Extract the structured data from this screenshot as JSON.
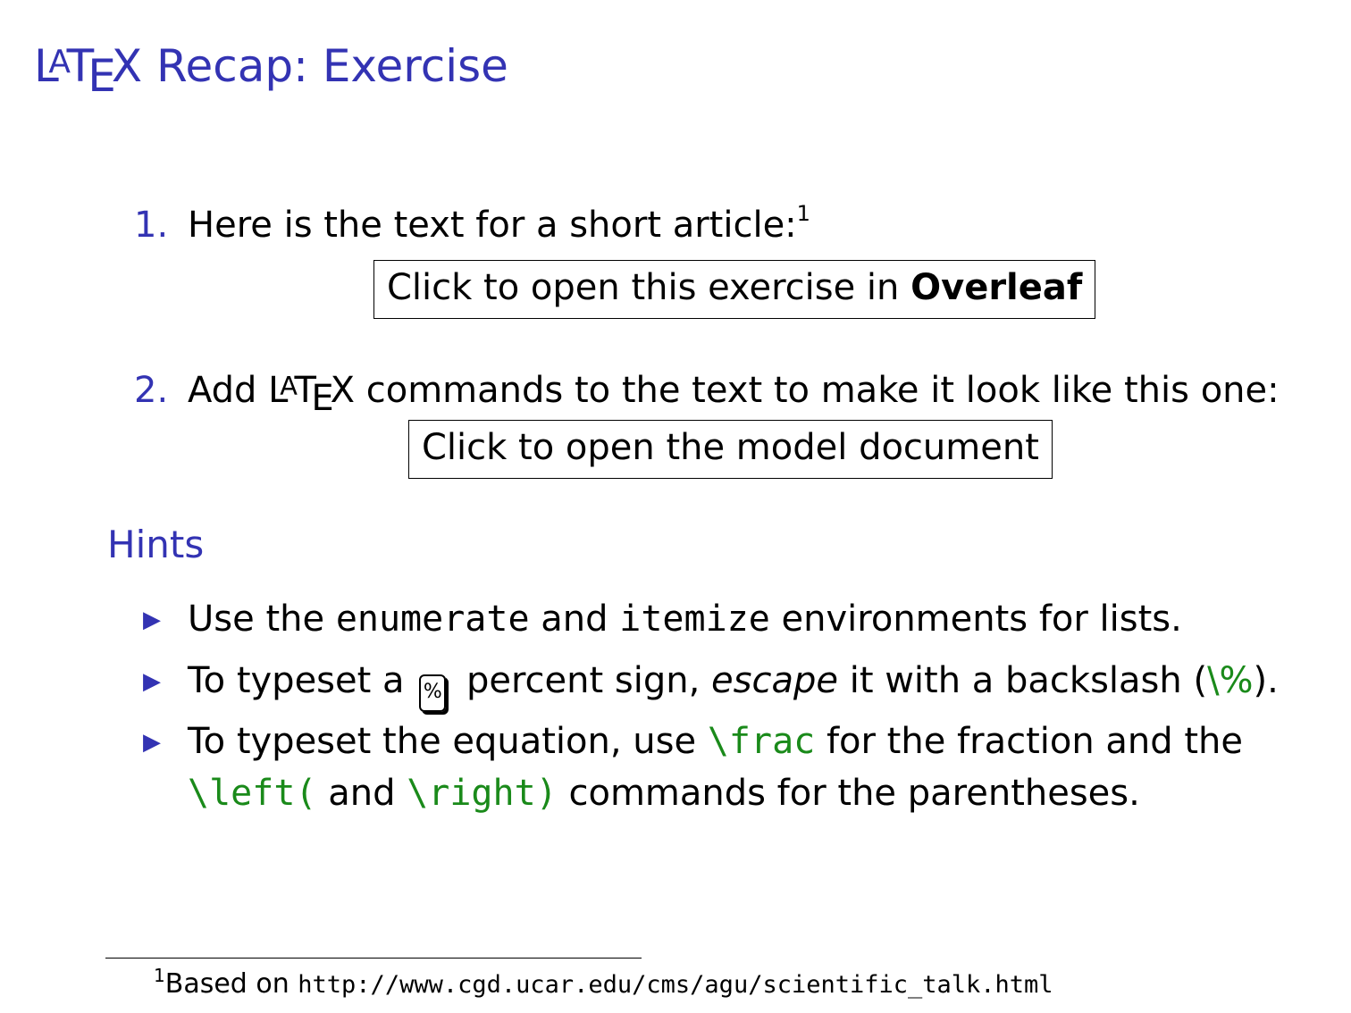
{
  "title": {
    "logo_L": "L",
    "logo_A": "A",
    "logo_T": "T",
    "logo_E": "E",
    "logo_X": "X",
    "text": " Recap: Exercise"
  },
  "enumerate": [
    {
      "number": "1.",
      "text": "Here is the text for a short article:",
      "footnote_mark": "1",
      "link": {
        "prefix": "Click to open this exercise in ",
        "bold": "Overleaf"
      }
    },
    {
      "number": "2.",
      "prefix": "Add ",
      "suffix": " commands to the text to make it look like this one:",
      "link": {
        "text": "Click to open the model document"
      }
    }
  ],
  "hints": {
    "heading": "Hints",
    "items": [
      {
        "t1": "Use the ",
        "code1": "enumerate",
        "t2": " and ",
        "code2": "itemize",
        "t3": " environments for lists."
      },
      {
        "t1": "To typeset a ",
        "key": "%",
        "t2": " percent sign, ",
        "em": "escape",
        "t3": " it with a backslash (",
        "code": "\\%",
        "t4": ")."
      },
      {
        "t1": "To typeset the equation, use ",
        "code1": "\\frac",
        "t2": " for the fraction and the",
        "code2": "\\left(",
        "t3": " and ",
        "code3": "\\right)",
        "t4": " commands for the parentheses."
      }
    ]
  },
  "footnote": {
    "mark": "1",
    "text": "Based on ",
    "url": "http://www.cgd.ucar.edu/cms/agu/scientific_talk.html"
  },
  "colors": {
    "structure_blue": "#3333b3",
    "code_green": "#1a8a1a"
  }
}
